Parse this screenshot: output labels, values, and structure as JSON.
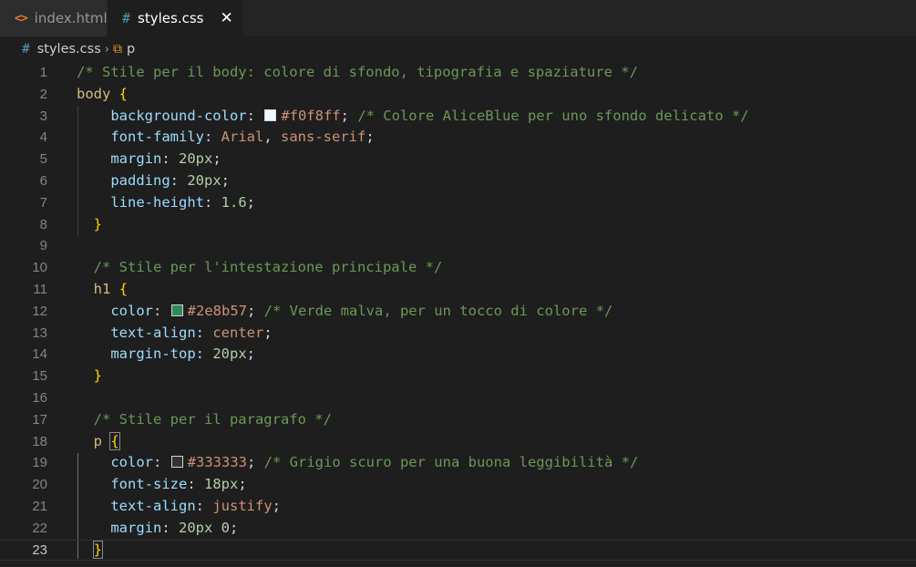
{
  "tabs": [
    {
      "icon": "<>",
      "label": "index.html",
      "active": false
    },
    {
      "icon": "#",
      "label": "styles.css",
      "active": true,
      "close": "✕"
    }
  ],
  "breadcrumb": {
    "file_icon": "#",
    "file": "styles.css",
    "separator": "›",
    "symbol_icon": "⧉",
    "symbol": "p"
  },
  "colors": {
    "swatch_body_bg": "#f0f8ff",
    "swatch_h1_color": "#2e8b57",
    "swatch_p_color": "#333333"
  },
  "lines": [
    {
      "n": "1",
      "tokens": [
        [
          "c-comment",
          "/* Stile per il body: colore di sfondo, tipografia e spaziature */"
        ]
      ]
    },
    {
      "n": "2",
      "tokens": [
        [
          "c-sel",
          "body"
        ],
        [
          "c-punct",
          " "
        ],
        [
          "c-brace",
          "{"
        ]
      ]
    },
    {
      "n": "3",
      "tokens": [
        [
          "c-punct",
          "    "
        ],
        [
          "c-prop",
          "background-color"
        ],
        [
          "c-punct",
          ": "
        ],
        [
          "swatch",
          "#f0f8ff"
        ],
        [
          "c-val",
          "#f0f8ff"
        ],
        [
          "c-punct",
          "; "
        ],
        [
          "c-comment",
          "/* Colore AliceBlue per uno sfondo delicato */"
        ]
      ]
    },
    {
      "n": "4",
      "tokens": [
        [
          "c-punct",
          "    "
        ],
        [
          "c-prop",
          "font-family"
        ],
        [
          "c-punct",
          ": "
        ],
        [
          "c-val",
          "Arial"
        ],
        [
          "c-punct",
          ", "
        ],
        [
          "c-val",
          "sans-serif"
        ],
        [
          "c-punct",
          ";"
        ]
      ]
    },
    {
      "n": "5",
      "tokens": [
        [
          "c-punct",
          "    "
        ],
        [
          "c-prop",
          "margin"
        ],
        [
          "c-punct",
          ": "
        ],
        [
          "c-num",
          "20px"
        ],
        [
          "c-punct",
          ";"
        ]
      ]
    },
    {
      "n": "6",
      "tokens": [
        [
          "c-punct",
          "    "
        ],
        [
          "c-prop",
          "padding"
        ],
        [
          "c-punct",
          ": "
        ],
        [
          "c-num",
          "20px"
        ],
        [
          "c-punct",
          ";"
        ]
      ]
    },
    {
      "n": "7",
      "tokens": [
        [
          "c-punct",
          "    "
        ],
        [
          "c-prop",
          "line-height"
        ],
        [
          "c-punct",
          ": "
        ],
        [
          "c-num",
          "1.6"
        ],
        [
          "c-punct",
          ";"
        ]
      ]
    },
    {
      "n": "8",
      "tokens": [
        [
          "c-punct",
          "  "
        ],
        [
          "c-brace",
          "}"
        ]
      ]
    },
    {
      "n": "9",
      "tokens": []
    },
    {
      "n": "10",
      "tokens": [
        [
          "c-punct",
          "  "
        ],
        [
          "c-comment",
          "/* Stile per l'intestazione principale */"
        ]
      ]
    },
    {
      "n": "11",
      "tokens": [
        [
          "c-punct",
          "  "
        ],
        [
          "c-sel",
          "h1"
        ],
        [
          "c-punct",
          " "
        ],
        [
          "c-brace",
          "{"
        ]
      ]
    },
    {
      "n": "12",
      "tokens": [
        [
          "c-punct",
          "    "
        ],
        [
          "c-prop",
          "color"
        ],
        [
          "c-punct",
          ": "
        ],
        [
          "swatch",
          "#2e8b57"
        ],
        [
          "c-val",
          "#2e8b57"
        ],
        [
          "c-punct",
          "; "
        ],
        [
          "c-comment",
          "/* Verde malva, per un tocco di colore */"
        ]
      ]
    },
    {
      "n": "13",
      "tokens": [
        [
          "c-punct",
          "    "
        ],
        [
          "c-prop",
          "text-align"
        ],
        [
          "c-punct",
          ": "
        ],
        [
          "c-val",
          "center"
        ],
        [
          "c-punct",
          ";"
        ]
      ]
    },
    {
      "n": "14",
      "tokens": [
        [
          "c-punct",
          "    "
        ],
        [
          "c-prop",
          "margin-top"
        ],
        [
          "c-punct",
          ": "
        ],
        [
          "c-num",
          "20px"
        ],
        [
          "c-punct",
          ";"
        ]
      ]
    },
    {
      "n": "15",
      "tokens": [
        [
          "c-punct",
          "  "
        ],
        [
          "c-brace",
          "}"
        ]
      ]
    },
    {
      "n": "16",
      "tokens": []
    },
    {
      "n": "17",
      "tokens": [
        [
          "c-punct",
          "  "
        ],
        [
          "c-comment",
          "/* Stile per il paragrafo */"
        ]
      ]
    },
    {
      "n": "18",
      "tokens": [
        [
          "c-punct",
          "  "
        ],
        [
          "c-sel",
          "p"
        ],
        [
          "c-punct",
          " "
        ],
        [
          "c-brace match",
          "{"
        ]
      ]
    },
    {
      "n": "19",
      "tokens": [
        [
          "c-punct",
          "    "
        ],
        [
          "c-prop",
          "color"
        ],
        [
          "c-punct",
          ": "
        ],
        [
          "swatch",
          "#333333"
        ],
        [
          "c-val",
          "#333333"
        ],
        [
          "c-punct",
          "; "
        ],
        [
          "c-comment",
          "/* Grigio scuro per una buona leggibilità */"
        ]
      ]
    },
    {
      "n": "20",
      "tokens": [
        [
          "c-punct",
          "    "
        ],
        [
          "c-prop",
          "font-size"
        ],
        [
          "c-punct",
          ": "
        ],
        [
          "c-num",
          "18px"
        ],
        [
          "c-punct",
          ";"
        ]
      ]
    },
    {
      "n": "21",
      "tokens": [
        [
          "c-punct",
          "    "
        ],
        [
          "c-prop",
          "text-align"
        ],
        [
          "c-punct",
          ": "
        ],
        [
          "c-val",
          "justify"
        ],
        [
          "c-punct",
          ";"
        ]
      ]
    },
    {
      "n": "22",
      "tokens": [
        [
          "c-punct",
          "    "
        ],
        [
          "c-prop",
          "margin"
        ],
        [
          "c-punct",
          ": "
        ],
        [
          "c-num",
          "20px"
        ],
        [
          "c-punct",
          " "
        ],
        [
          "c-num",
          "0"
        ],
        [
          "c-punct",
          ";"
        ]
      ]
    },
    {
      "n": "23",
      "tokens": [
        [
          "c-punct",
          "  "
        ],
        [
          "c-brace match",
          "}"
        ]
      ],
      "current": true
    }
  ]
}
